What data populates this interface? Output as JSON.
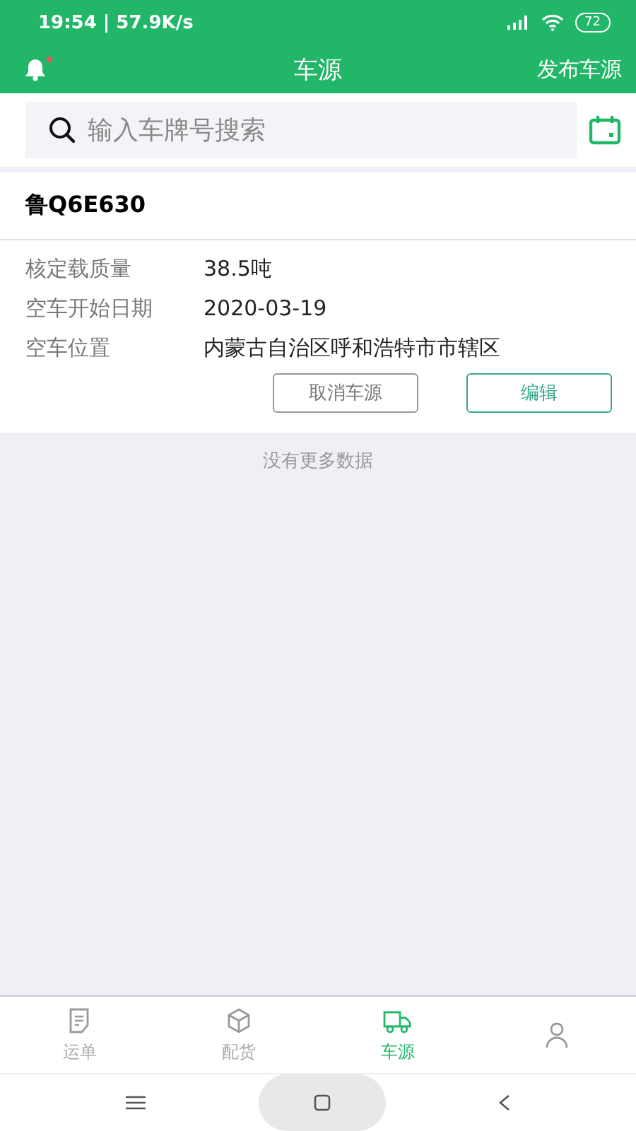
{
  "status_bar": {
    "time_speed": "19:54 | 57.9K/s",
    "battery": "72"
  },
  "header": {
    "title": "车源",
    "action": "发布车源",
    "notification_dot": true
  },
  "search": {
    "placeholder": "输入车牌号搜索"
  },
  "vehicles": [
    {
      "plate": "鲁Q6E630",
      "fields": [
        {
          "label": "核定载质量",
          "value": "38.5吨"
        },
        {
          "label": "空车开始日期",
          "value": "2020-03-19"
        },
        {
          "label": "空车位置",
          "value": "内蒙古自治区呼和浩特市市辖区"
        }
      ],
      "buttons": [
        {
          "label": "取消车源",
          "kind": "plain"
        },
        {
          "label": "编辑",
          "kind": "primary"
        }
      ]
    }
  ],
  "list_end": "没有更多数据",
  "tabs": [
    {
      "label": "运单",
      "selected": false
    },
    {
      "label": "配货",
      "selected": false
    },
    {
      "label": "车源",
      "selected": true
    },
    {
      "selected": false
    }
  ]
}
